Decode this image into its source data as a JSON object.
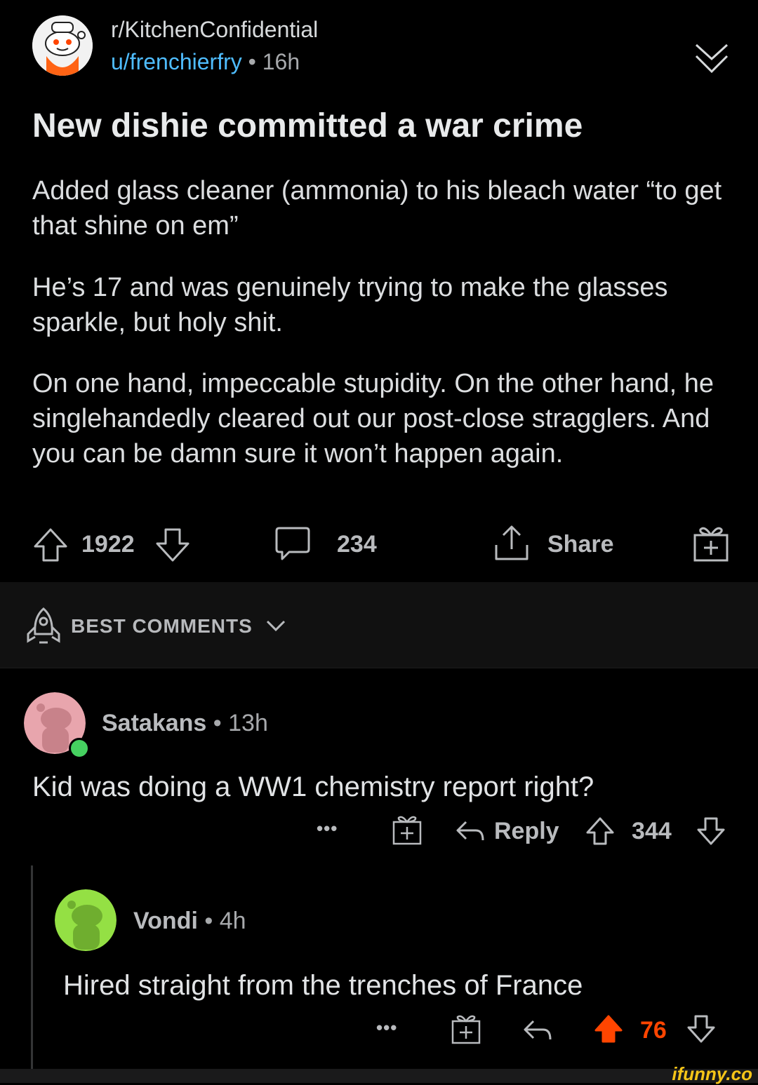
{
  "post": {
    "subreddit": "r/KitchenConfidential",
    "user": "u/frenchierfry",
    "separator": "•",
    "age": "16h",
    "title": "New dishie committed a war crime",
    "paragraphs": [
      "Added glass cleaner (ammonia) to his bleach water “to get that shine on em”",
      "He’s 17 and was genuinely trying to make the glasses sparkle, but holy shit.",
      "On one hand, impeccable stupidity. On the other hand, he singlehandedly cleared out our post-close stragglers. And you can be damn sure it won’t happen again."
    ],
    "votes": "1922",
    "comments_count": "234",
    "share_label": "Share"
  },
  "sort": {
    "label": "BEST COMMENTS"
  },
  "comments": [
    {
      "user": "Satakans",
      "separator": "•",
      "age": "13h",
      "text": "Kid was doing a WW1 chemistry report right?",
      "more": "•••",
      "reply_label": "Reply",
      "votes": "344",
      "avatar_color": "#e8a5ad",
      "online_color": "#46d160"
    },
    {
      "user": "Vondi",
      "separator": "•",
      "age": "4h",
      "text": "Hired straight from the trenches of France",
      "more": "•••",
      "votes": "76",
      "avatar_color": "#94e044",
      "upvoted_color": "#ff4500"
    }
  ],
  "watermark": "ifunny.co",
  "colors": {
    "link": "#4fbdff",
    "upvote": "#ff4500",
    "background": "#000000"
  }
}
